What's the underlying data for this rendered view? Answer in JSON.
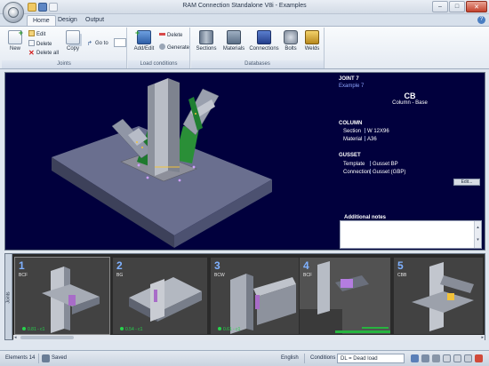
{
  "window": {
    "title": "RAM Connection Standalone V8i - Examples",
    "minimize": "–",
    "maximize": "□",
    "close": "✕"
  },
  "ribbon": {
    "tabs": [
      "Home",
      "Design",
      "Output"
    ],
    "help": "?",
    "groups": {
      "joints": {
        "label": "Joints",
        "new": "New",
        "edit": "Edit",
        "delete": "Delete",
        "delete_all": "Delete all",
        "copy": "Copy",
        "go_to": "Go to"
      },
      "load_conditions": {
        "label": "Load conditions",
        "add_edit": "Add/Edit",
        "delete": "Delete",
        "generate": "Generate"
      },
      "databases": {
        "label": "Databases",
        "sections": "Sections",
        "materials": "Materials",
        "connections": "Connections",
        "bolts": "Bolts",
        "welds": "Welds"
      }
    }
  },
  "info_panel": {
    "joint_title": "JOINT 7",
    "example": "Example 7",
    "code": "CB",
    "code_desc": "Column - Base",
    "column_head": "COLUMN",
    "section_label": "Section",
    "section_value": "W 12X96",
    "material_label": "Material",
    "material_value": "A36",
    "gusset_head": "GUSSET",
    "template_label": "Template",
    "template_value": "Gusset BP",
    "connection_label": "Connection",
    "connection_value": "Gusset (GBP)",
    "edit_button": "Edit...",
    "notes_label": "Additional notes",
    "notes_up": "▴",
    "notes_down": "▾"
  },
  "joints_strip": {
    "side_label": "Joints",
    "items": [
      {
        "number": "1",
        "code": "BCF",
        "ratio": "0.81 - c1"
      },
      {
        "number": "2",
        "code": "BG",
        "ratio": "0.54 - c1"
      },
      {
        "number": "3",
        "code": "BCW",
        "ratio": "0.61 - c1"
      },
      {
        "number": "4",
        "code": "BCF",
        "ratio": ""
      },
      {
        "number": "5",
        "code": "CBB",
        "ratio": ""
      }
    ],
    "scroll_left": "◂",
    "scroll_right": "▸"
  },
  "status": {
    "elements": "Elements 14",
    "saved": "Saved",
    "language": "English",
    "conditions_label": "Conditions",
    "conditions_value": "DL = Dead load"
  },
  "colors": {
    "viewport_bg": "#01003d",
    "thumb_bg": "#424242",
    "accent_blue": "#7fb1ff",
    "ok_green": "#27d34c",
    "ribbon_bg": "#e4eaf2"
  }
}
